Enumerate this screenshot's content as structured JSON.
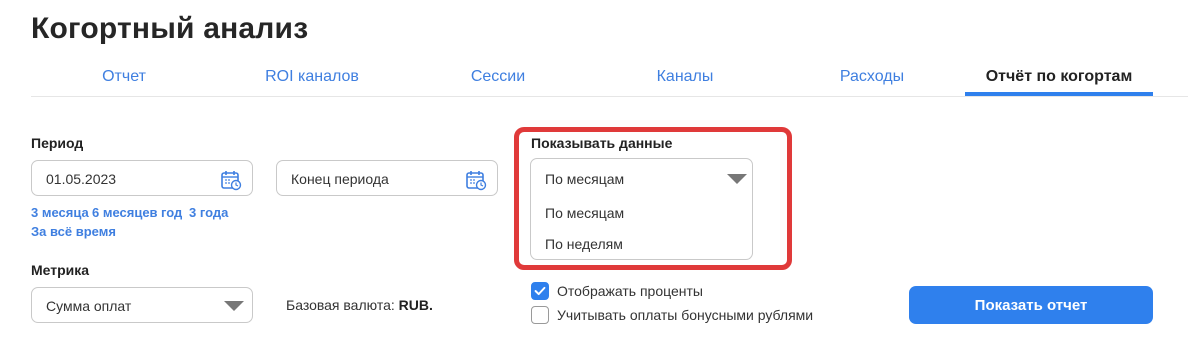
{
  "page": {
    "title": "Когортный анализ"
  },
  "tabs": [
    {
      "label": "Отчет"
    },
    {
      "label": "ROI каналов"
    },
    {
      "label": "Сессии"
    },
    {
      "label": "Каналы"
    },
    {
      "label": "Расходы"
    },
    {
      "label": "Отчёт по когортам",
      "active": true
    }
  ],
  "period": {
    "label": "Период",
    "start_value": "01.05.2023",
    "end_placeholder": "Конец периода",
    "quick": [
      "3 месяца",
      "6 месяцев",
      "год",
      "3 года",
      "За всё время"
    ]
  },
  "metric": {
    "label": "Метрика",
    "value": "Сумма оплат"
  },
  "currency": {
    "label": "Базовая валюта:",
    "value": "RUB."
  },
  "show_data": {
    "label": "Показывать данные",
    "selected": "По месяцам",
    "options": [
      "По месяцам",
      "По неделям"
    ]
  },
  "checkboxes": [
    {
      "label": "Отображать проценты",
      "checked": true
    },
    {
      "label": "Учитывать оплаты бонусными рублями",
      "checked": false
    }
  ],
  "submit": {
    "label": "Показать отчет"
  },
  "colors": {
    "accent": "#2f80ed",
    "link": "#3f7fe0",
    "highlight": "#e03a3a"
  },
  "icons": [
    "calendar-icon",
    "chevron-down-icon",
    "checkmark-icon"
  ]
}
